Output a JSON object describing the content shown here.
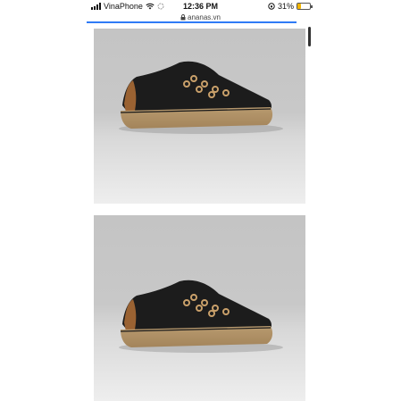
{
  "status_bar": {
    "carrier": "VinaPhone",
    "time": "12:36 PM",
    "battery_percent": "31%",
    "battery_level": 0.31
  },
  "browser": {
    "url": "ananas.vn"
  },
  "icons": {
    "signal": "signal-bars-icon",
    "wifi": "wifi-icon",
    "loading": "loading-spinner-icon",
    "lock": "lock-icon",
    "orientation_lock": "orientation-lock-icon",
    "battery": "battery-icon"
  },
  "colors": {
    "progress_bar": "#2f7bf6",
    "battery_fill": "#f2b400"
  }
}
